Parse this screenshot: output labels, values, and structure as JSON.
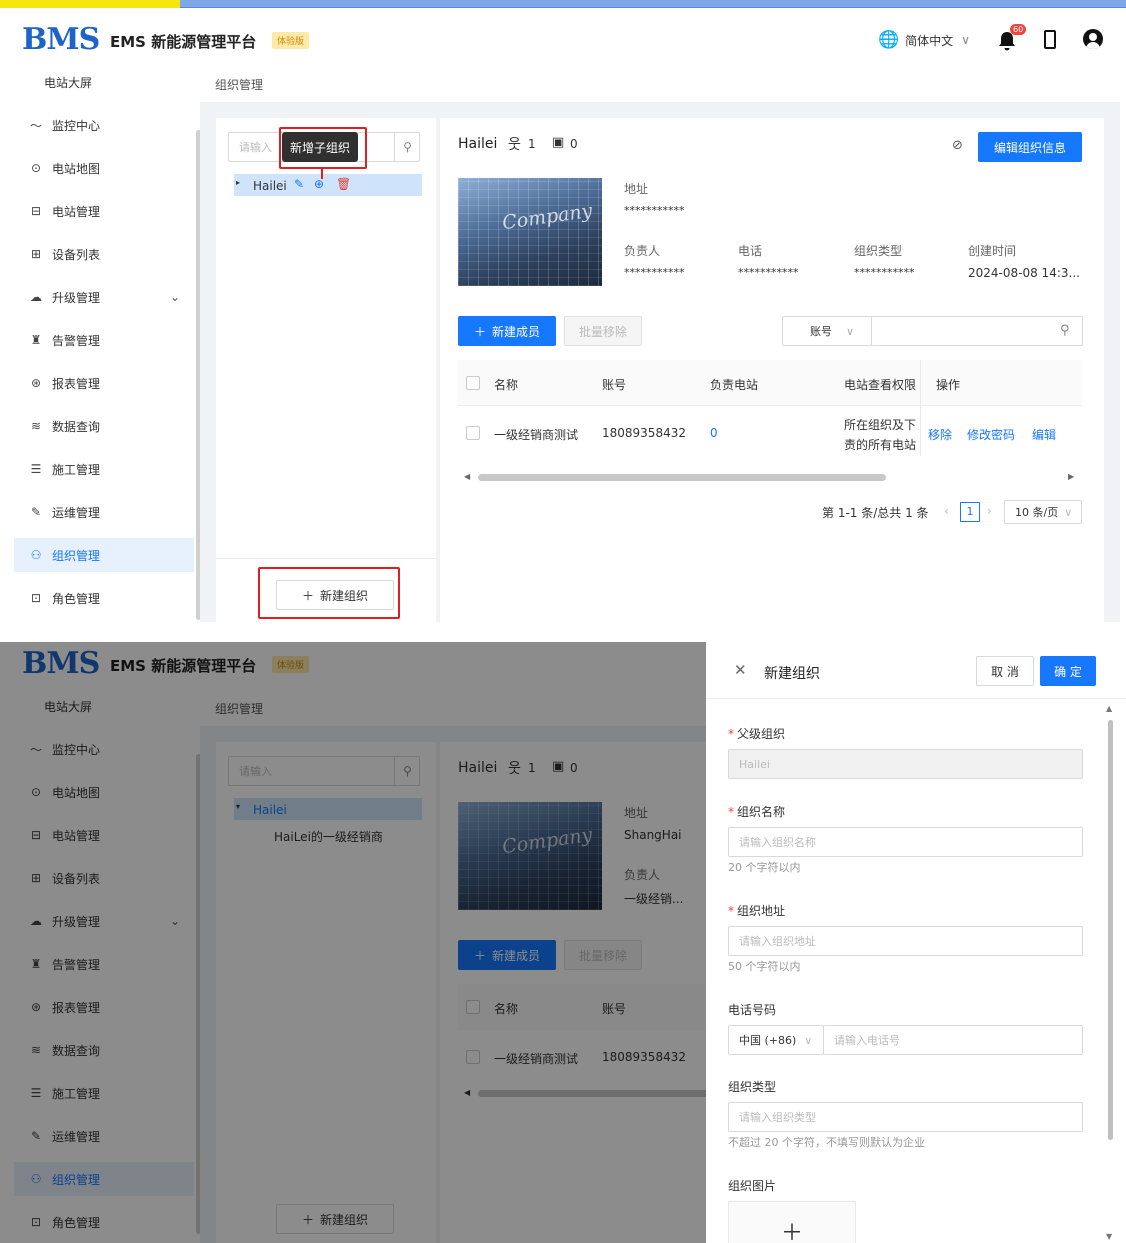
{
  "app": {
    "logo": "BMS",
    "title": "EMS 新能源管理平台",
    "badge": "体验版"
  },
  "header": {
    "language": "简体中文",
    "notification_count": "60"
  },
  "sidebar": {
    "items": [
      {
        "label": "电站大屏",
        "icon": "dashboard-icon"
      },
      {
        "label": "监控中心",
        "icon": "trend-icon"
      },
      {
        "label": "电站地图",
        "icon": "map-pin-icon"
      },
      {
        "label": "电站管理",
        "icon": "station-icon"
      },
      {
        "label": "设备列表",
        "icon": "device-icon"
      },
      {
        "label": "升级管理",
        "icon": "upgrade-icon"
      },
      {
        "label": "告警管理",
        "icon": "alarm-icon"
      },
      {
        "label": "报表管理",
        "icon": "report-icon"
      },
      {
        "label": "数据查询",
        "icon": "data-icon"
      },
      {
        "label": "施工管理",
        "icon": "construction-icon"
      },
      {
        "label": "运维管理",
        "icon": "wrench-icon"
      },
      {
        "label": "组织管理",
        "icon": "org-icon"
      },
      {
        "label": "角色管理",
        "icon": "role-icon"
      }
    ]
  },
  "breadcrumb": "组织管理",
  "tree": {
    "search_placeholder": "请输入",
    "tooltip": "新增子组织",
    "root": "Hailei",
    "child": "HaiLei的一级经销商",
    "add_button": "新建组织"
  },
  "org": {
    "name": "Hailei",
    "member_count": "1",
    "station_count": "0",
    "edit_button": "编辑组织信息",
    "company_image_text": "Company",
    "address_label": "地址",
    "address_masked": "***********",
    "address_value": "ShangHai",
    "owner_label": "负责人",
    "owner_masked": "***********",
    "owner_value": "一级经销...",
    "phone_label": "电话",
    "phone_masked": "***********",
    "type_label": "组织类型",
    "type_masked": "***********",
    "created_label": "创建时间",
    "created_value": "2024-08-08 14:3..."
  },
  "members": {
    "new_button": "新建成员",
    "batch_remove": "批量移除",
    "filter_select": "账号",
    "columns": [
      "名称",
      "账号",
      "负责电站",
      "电站查看权限",
      "操作"
    ],
    "rows": [
      {
        "name": "一级经销商测试",
        "account": "18089358432",
        "stations": "0",
        "permission_line1": "所在组织及下",
        "permission_line2": "责的所有电站",
        "actions": [
          "移除",
          "修改密码",
          "编辑"
        ]
      }
    ],
    "pagination": {
      "summary": "第 1-1 条/总共 1 条",
      "page": "1",
      "page_size": "10 条/页"
    }
  },
  "drawer": {
    "title": "新建组织",
    "cancel": "取 消",
    "confirm": "确 定",
    "parent_label": "父级组织",
    "parent_value": "Hailei",
    "name_label": "组织名称",
    "name_placeholder": "请输入组织名称",
    "name_hint": "20 个字符以内",
    "address_label": "组织地址",
    "address_placeholder": "请输入组织地址",
    "address_hint": "50 个字符以内",
    "phone_label": "电话号码",
    "phone_code": "中国 (+86)",
    "phone_placeholder": "请输入电话号",
    "type_label": "组织类型",
    "type_placeholder": "请输入组织类型",
    "type_hint": "不超过 20 个字符，不填写则默认为企业",
    "image_label": "组织图片"
  },
  "colors": {
    "primary": "#1677ff",
    "annotation_red": "#e02020",
    "brand_blue": "#1e64c8"
  }
}
